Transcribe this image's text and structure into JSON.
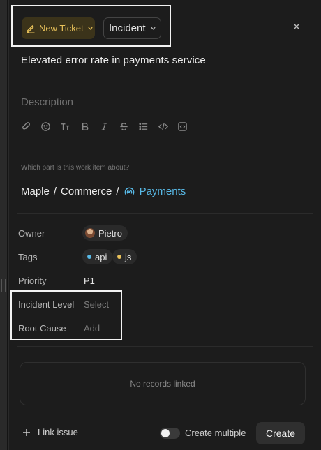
{
  "header": {
    "type_chip": {
      "label": "New Ticket",
      "icon": "pencil-icon",
      "color": "#e8c15a"
    },
    "status_chip": {
      "label": "Incident"
    },
    "close_icon": "close-icon"
  },
  "ticket": {
    "title": "Elevated error rate in payments service",
    "description_placeholder": "Description",
    "toolbar": [
      "attach-icon",
      "emoji-icon",
      "text-size-icon",
      "bold-icon",
      "italic-icon",
      "strikethrough-icon",
      "bullet-list-icon",
      "code-icon",
      "code-block-icon"
    ]
  },
  "location": {
    "question": "Which part is this work item about?",
    "path": [
      "Maple",
      "Commerce"
    ],
    "separator": "/",
    "current": "Payments",
    "current_color": "#58b9e6"
  },
  "properties": {
    "owner": {
      "label": "Owner",
      "value": "Pietro"
    },
    "tags": {
      "label": "Tags",
      "values": [
        {
          "name": "api",
          "color": "#58b9e6"
        },
        {
          "name": "js",
          "color": "#e8c15a"
        }
      ]
    },
    "priority": {
      "label": "Priority",
      "value": "P1"
    },
    "incident_level": {
      "label": "Incident Level",
      "placeholder": "Select"
    },
    "root_cause": {
      "label": "Root Cause",
      "placeholder": "Add"
    }
  },
  "records": {
    "empty_text": "No records linked"
  },
  "footer": {
    "link_issue": "Link issue",
    "create_multiple": "Create multiple",
    "create_multiple_on": false,
    "create": "Create"
  }
}
